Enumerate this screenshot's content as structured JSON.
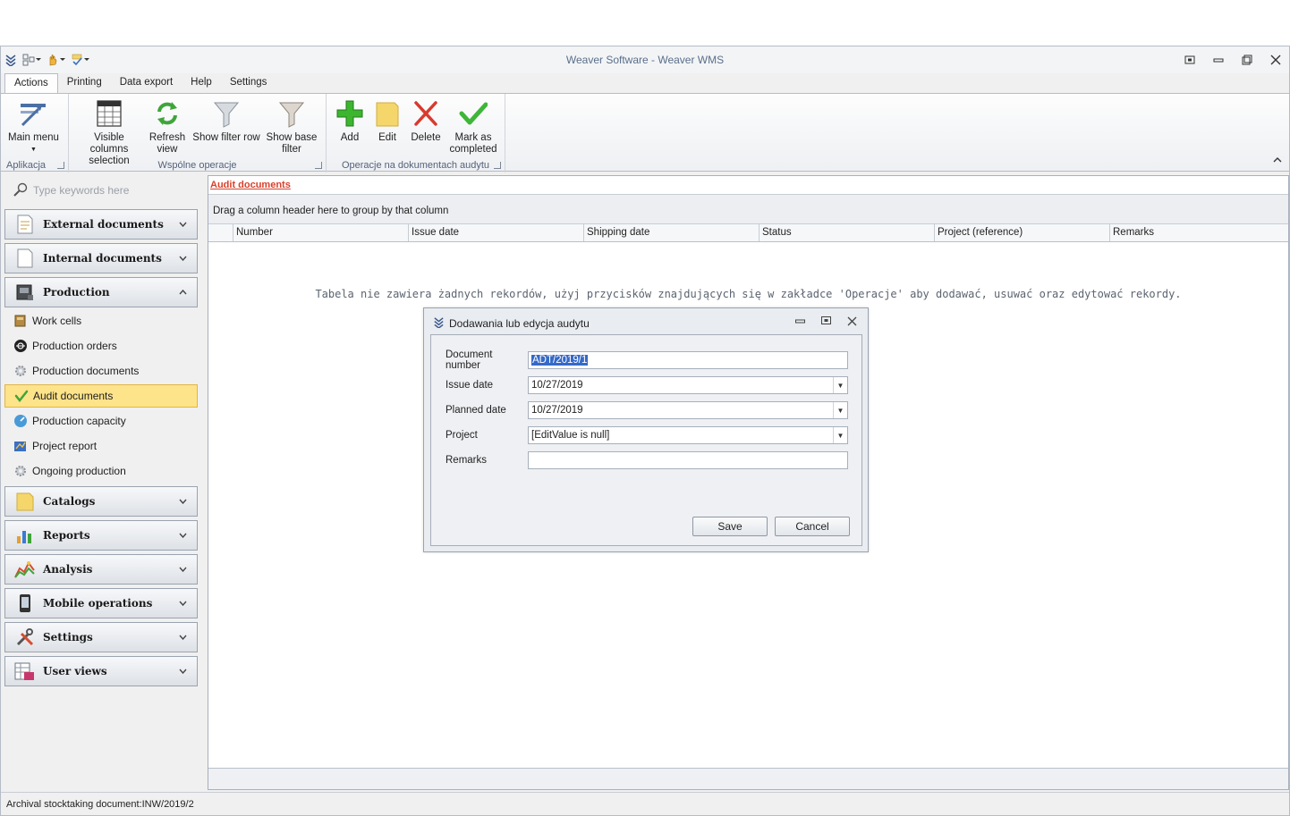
{
  "window": {
    "title": "Weaver Software - Weaver WMS",
    "controls": [
      "restore-icon",
      "minimize-icon",
      "maximize-icon",
      "close-icon"
    ]
  },
  "ribbon_tabs": [
    "Actions",
    "Printing",
    "Data export",
    "Help",
    "Settings"
  ],
  "ribbon": {
    "groups": {
      "app": "Aplikacja",
      "common": "Wspólne operacje",
      "audit_ops": "Operacje na dokumentach audytu"
    },
    "buttons": {
      "main_menu": "Main menu",
      "visible_columns": "Visible columns selection",
      "refresh": "Refresh view",
      "show_filter": "Show filter row",
      "show_base_filter": "Show base filter",
      "add": "Add",
      "edit": "Edit",
      "delete": "Delete",
      "mark_completed": "Mark as completed"
    }
  },
  "nav": {
    "search_placeholder": "Type keywords here",
    "groups": {
      "external": "External documents",
      "internal": "Internal documents",
      "production": "Production",
      "catalogs": "Catalogs",
      "reports": "Reports",
      "analysis": "Analysis",
      "mobile": "Mobile operations",
      "settings": "Settings",
      "user_views": "User views"
    },
    "production_items": {
      "work_cells": "Work cells",
      "production_orders": "Production orders",
      "production_documents": "Production documents",
      "audit_documents": "Audit documents",
      "production_capacity": "Production capacity",
      "project_report": "Project report",
      "ongoing_production": "Ongoing production"
    }
  },
  "content": {
    "doc_tab": "Audit documents",
    "group_panel_text": "Drag a column header here to group by that column",
    "columns": {
      "number": "Number",
      "issue_date": "Issue date",
      "shipping_date": "Shipping date",
      "status": "Status",
      "project": "Project (reference)",
      "remarks": "Remarks"
    },
    "empty_message": "Tabela nie zawiera żadnych rekordów, użyj przycisków znajdujących się w zakładce 'Operacje' aby dodawać, usuwać oraz edytować rekordy."
  },
  "dialog": {
    "title": "Dodawania lub edycja audytu",
    "fields": {
      "document_number": {
        "label": "Document number",
        "value": "ADT/2019/1"
      },
      "issue_date": {
        "label": "Issue date",
        "value": "10/27/2019"
      },
      "planned_date": {
        "label": "Planned date",
        "value": "10/27/2019"
      },
      "project": {
        "label": "Project",
        "value": "[EditValue is null]"
      },
      "remarks": {
        "label": "Remarks",
        "value": ""
      }
    },
    "save": "Save",
    "cancel": "Cancel"
  },
  "status_bar": "Archival stocktaking document:INW/2019/2",
  "colors": {
    "accent_red": "#d9402b",
    "selected_item": "#fde38a",
    "title_text": "#5a6f8a",
    "selection_blue": "#3569c8"
  }
}
